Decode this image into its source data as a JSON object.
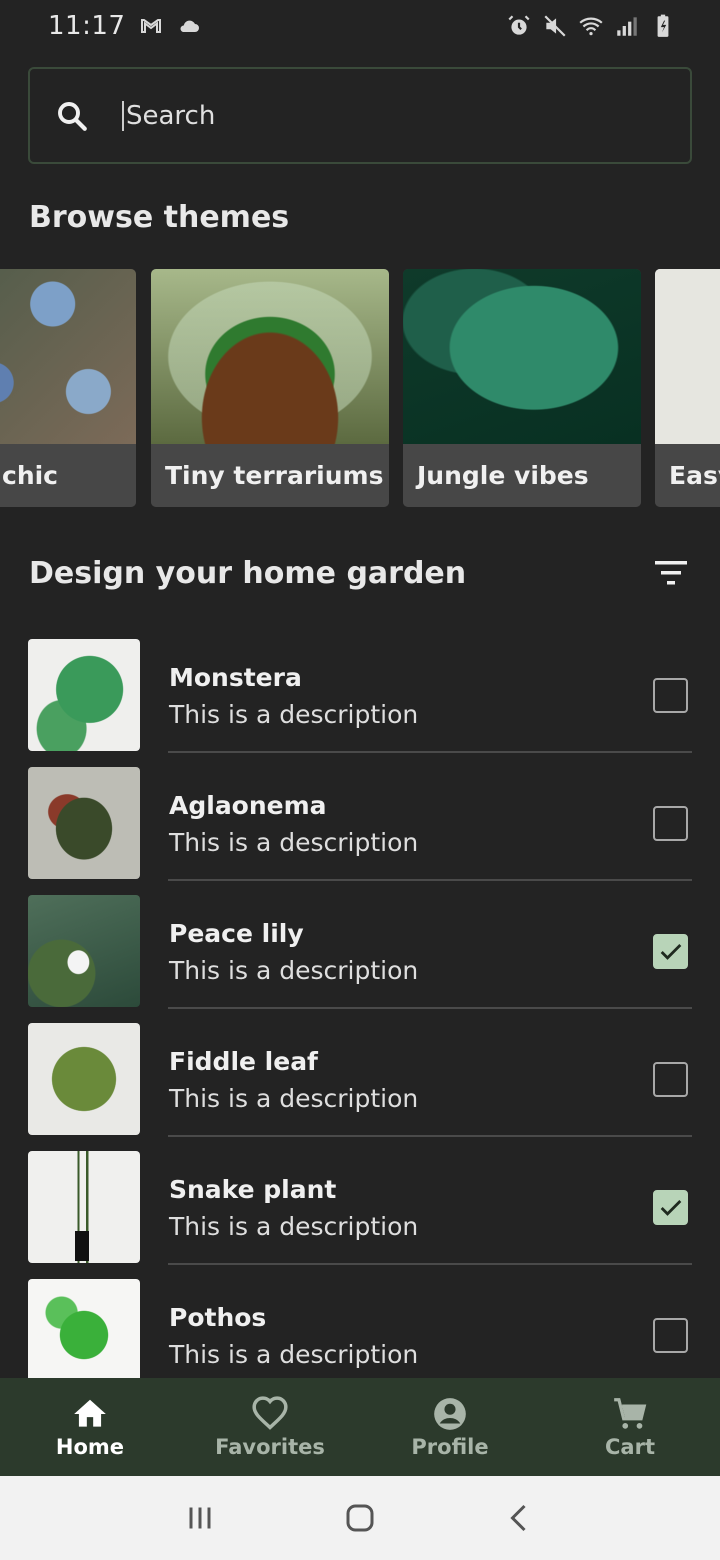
{
  "status_bar": {
    "time": "11:17",
    "left_icons": [
      "gmail-icon",
      "cloud-icon"
    ],
    "right_icons": [
      "alarm-icon",
      "mute-icon",
      "wifi-icon",
      "signal-icon",
      "battery-icon"
    ]
  },
  "search": {
    "placeholder": "Search"
  },
  "browse": {
    "title": "Browse themes",
    "themes": [
      {
        "label": "chic",
        "image": "succulents"
      },
      {
        "label": "Tiny terrariums",
        "image": "terrarium"
      },
      {
        "label": "Jungle vibes",
        "image": "monstera-leaf"
      },
      {
        "label": "Easy",
        "image": "bright-room"
      }
    ]
  },
  "design": {
    "title": "Design your home garden",
    "filter_icon": "filter-icon",
    "plants": [
      {
        "name": "Monstera",
        "description": "This is a description",
        "checked": false
      },
      {
        "name": "Aglaonema",
        "description": "This is a description",
        "checked": false
      },
      {
        "name": "Peace lily",
        "description": "This is a description",
        "checked": true
      },
      {
        "name": "Fiddle leaf",
        "description": "This is a description",
        "checked": false
      },
      {
        "name": "Snake plant",
        "description": "This is a description",
        "checked": true
      },
      {
        "name": "Pothos",
        "description": "This is a description",
        "checked": false
      }
    ]
  },
  "bottom_nav": {
    "items": [
      {
        "label": "Home",
        "icon": "home-icon",
        "active": true
      },
      {
        "label": "Favorites",
        "icon": "heart-icon",
        "active": false
      },
      {
        "label": "Profile",
        "icon": "account-circle-icon",
        "active": false
      },
      {
        "label": "Cart",
        "icon": "cart-icon",
        "active": false
      }
    ]
  },
  "colors": {
    "background": "#232323",
    "bottom_nav_bg": "#2c3a2c",
    "checkbox_checked": "#b8d4b8",
    "search_border": "#3a4a3a"
  }
}
